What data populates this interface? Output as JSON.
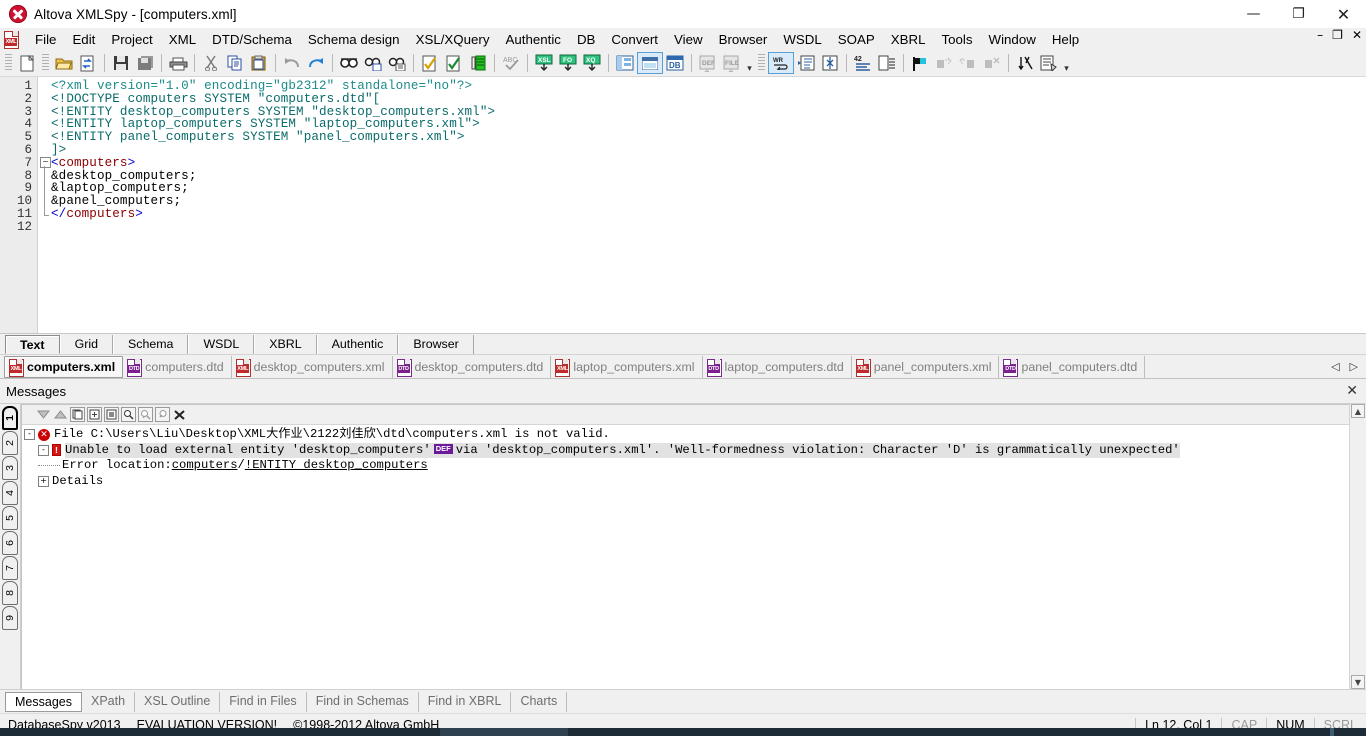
{
  "window": {
    "title": "Altova XMLSpy - [computers.xml]",
    "minimize": "—",
    "maximize": "❐",
    "close": "✕",
    "mdi_minimize": "–",
    "mdi_restore": "❐",
    "mdi_close": "✕"
  },
  "menubar": {
    "items": [
      {
        "label": "File",
        "accel": "F"
      },
      {
        "label": "Edit",
        "accel": "E"
      },
      {
        "label": "Project",
        "accel": "P"
      },
      {
        "label": "XML",
        "accel": "X"
      },
      {
        "label": "DTD/Schema",
        "accel": "S"
      },
      {
        "label": "Schema design",
        "accel": "m"
      },
      {
        "label": "XSL/XQuery",
        "accel": "Q"
      },
      {
        "label": "Authentic",
        "accel": "A"
      },
      {
        "label": "DB",
        "accel": "D"
      },
      {
        "label": "Convert",
        "accel": "C"
      },
      {
        "label": "View",
        "accel": "V"
      },
      {
        "label": "Browser",
        "accel": "B"
      },
      {
        "label": "WSDL",
        "accel": "L"
      },
      {
        "label": "SOAP",
        "accel": "O"
      },
      {
        "label": "XBRL",
        "accel": "R"
      },
      {
        "label": "Tools",
        "accel": "T"
      },
      {
        "label": "Window",
        "accel": "W"
      },
      {
        "label": "Help",
        "accel": "H"
      }
    ]
  },
  "toolbar": {
    "buttons": [
      "new-file-icon",
      "open-folder-icon",
      "reload-icon",
      "save-icon",
      "save-all-icon",
      "print-icon",
      "cut-icon",
      "copy-icon",
      "paste-icon",
      "undo-icon",
      "redo-icon",
      "find-icon",
      "find-next-icon",
      "find-in-files-icon",
      "check-well-formed-icon",
      "validate-icon",
      "insert-entity-icon",
      "spell-check-icon",
      "xsl-transform-icon",
      "fo-transform-icon",
      "xquery-execute-icon",
      "grid-view-icon",
      "text-view-icon",
      "database-view-icon",
      "dtd-assign-icon",
      "file-assign-icon",
      "word-wrap-icon",
      "pretty-print-icon",
      "expand-collapse-icon",
      "line-numbers-icon",
      "indent-guides-icon",
      "bookmark-toggle-icon",
      "bookmark-next-icon",
      "bookmark-prev-icon",
      "bookmark-clear-icon",
      "sort-icon",
      "script-icon"
    ]
  },
  "editor": {
    "line_numbers": [
      "1",
      "2",
      "3",
      "4",
      "5",
      "6",
      "7",
      "8",
      "9",
      "10",
      "11",
      "12"
    ],
    "lines": [
      {
        "n": 1,
        "tokens": [
          {
            "t": "<?xml version=\"1.0\" encoding=\"gb2312\" standalone=\"no\"?>",
            "c": "c-pi"
          }
        ]
      },
      {
        "n": 2,
        "tokens": [
          {
            "t": "<!DOCTYPE computers SYSTEM \"computers.dtd\"[",
            "c": "c-dtd"
          }
        ]
      },
      {
        "n": 3,
        "tokens": [
          {
            "t": "<!ENTITY desktop_computers SYSTEM \"desktop_computers.xml\">",
            "c": "c-dtd"
          }
        ]
      },
      {
        "n": 4,
        "tokens": [
          {
            "t": "<!ENTITY laptop_computers SYSTEM \"laptop_computers.xml\">",
            "c": "c-dtd"
          }
        ]
      },
      {
        "n": 5,
        "tokens": [
          {
            "t": "<!ENTITY panel_computers SYSTEM \"panel_computers.xml\">",
            "c": "c-dtd"
          }
        ]
      },
      {
        "n": 6,
        "tokens": [
          {
            "t": "]>",
            "c": "c-dtd"
          }
        ]
      },
      {
        "n": 7,
        "tokens": [
          {
            "t": "<",
            "c": "c-brk"
          },
          {
            "t": "computers",
            "c": "c-tag"
          },
          {
            "t": ">",
            "c": "c-brk"
          }
        ]
      },
      {
        "n": 8,
        "tokens": [
          {
            "t": "&desktop_computers;",
            "c": "c-txt"
          }
        ]
      },
      {
        "n": 9,
        "tokens": [
          {
            "t": "&laptop_computers;",
            "c": "c-txt"
          }
        ]
      },
      {
        "n": 10,
        "tokens": [
          {
            "t": "&panel_computers;",
            "c": "c-txt"
          }
        ]
      },
      {
        "n": 11,
        "tokens": [
          {
            "t": "</",
            "c": "c-brk"
          },
          {
            "t": "computers",
            "c": "c-tag"
          },
          {
            "t": ">",
            "c": "c-brk"
          }
        ]
      },
      {
        "n": 12,
        "tokens": []
      }
    ],
    "fold_marker": "-"
  },
  "view_tabs": {
    "items": [
      "Text",
      "Grid",
      "Schema",
      "WSDL",
      "XBRL",
      "Authentic",
      "Browser"
    ],
    "active": "Text"
  },
  "file_tabs": {
    "items": [
      {
        "label": "computers.xml",
        "type": "XML",
        "active": true
      },
      {
        "label": "computers.dtd",
        "type": "DTD",
        "active": false
      },
      {
        "label": "desktop_computers.xml",
        "type": "XML",
        "active": false
      },
      {
        "label": "desktop_computers.dtd",
        "type": "DTD",
        "active": false
      },
      {
        "label": "laptop_computers.xml",
        "type": "XML",
        "active": false
      },
      {
        "label": "laptop_computers.dtd",
        "type": "DTD",
        "active": false
      },
      {
        "label": "panel_computers.xml",
        "type": "XML",
        "active": false
      },
      {
        "label": "panel_computers.dtd",
        "type": "DTD",
        "active": false
      }
    ],
    "nav_prev": "◁",
    "nav_next": "▷"
  },
  "messages_panel": {
    "title": "Messages",
    "close": "✕",
    "vertical_tabs": [
      "1",
      "2",
      "3",
      "4",
      "5",
      "6",
      "7",
      "8",
      "9"
    ],
    "active_vertical_tab": "1",
    "toolbar_buttons": [
      "filter-down-icon",
      "filter-up-icon",
      "copy-line-icon",
      "copy-subtree-icon",
      "copy-all-icon",
      "find-icon",
      "find-next-icon",
      "find-prev-icon",
      "clear-icon"
    ],
    "rows": [
      {
        "id": "file-not-valid",
        "icon": "error-icon",
        "expander": "-",
        "text": "File C:\\Users\\Liu\\Desktop\\XML大作业\\2122刘佳欣\\dtd\\computers.xml is not valid."
      },
      {
        "id": "unable-to-load-entity",
        "icon": "warning-icon",
        "expander": "-",
        "text_before": "Unable to load external entity 'desktop_computers'",
        "chip": "DEF",
        "text_after": "via 'desktop_computers.xml'. 'Well-formedness violation: Character 'D' is grammatically unexpected'"
      },
      {
        "id": "error-location",
        "label": "Error location: ",
        "link1": "computers",
        "separator": " / ",
        "link2": "!ENTITY desktop_computers"
      },
      {
        "id": "details",
        "expander": "+",
        "text": "Details"
      }
    ],
    "scroll_up": "▲",
    "scroll_down": "▼"
  },
  "bottom_tabs": {
    "items": [
      "Messages",
      "XPath",
      "XSL Outline",
      "Find in Files",
      "Find in Schemas",
      "Find in XBRL",
      "Charts"
    ],
    "active": "Messages"
  },
  "status_bar": {
    "product": "DatabaseSpy v2013",
    "evaluation": "EVALUATION VERSION!",
    "copyright": "©1998-2012 Altova GmbH",
    "position": "Ln 12, Col 1",
    "cap": "CAP",
    "num": "NUM",
    "scrl": "SCRL"
  },
  "colors": {
    "chrome": "#f0f0f0",
    "error_red": "#cc0000",
    "xml_icon": "#c02a2a",
    "dtd_icon": "#7a1f8c",
    "pi_teal": "#1a8a8a",
    "tag_red": "#8b0000",
    "bracket_blue": "#0000cc",
    "selected_tab_border": "#5a9fd4"
  }
}
